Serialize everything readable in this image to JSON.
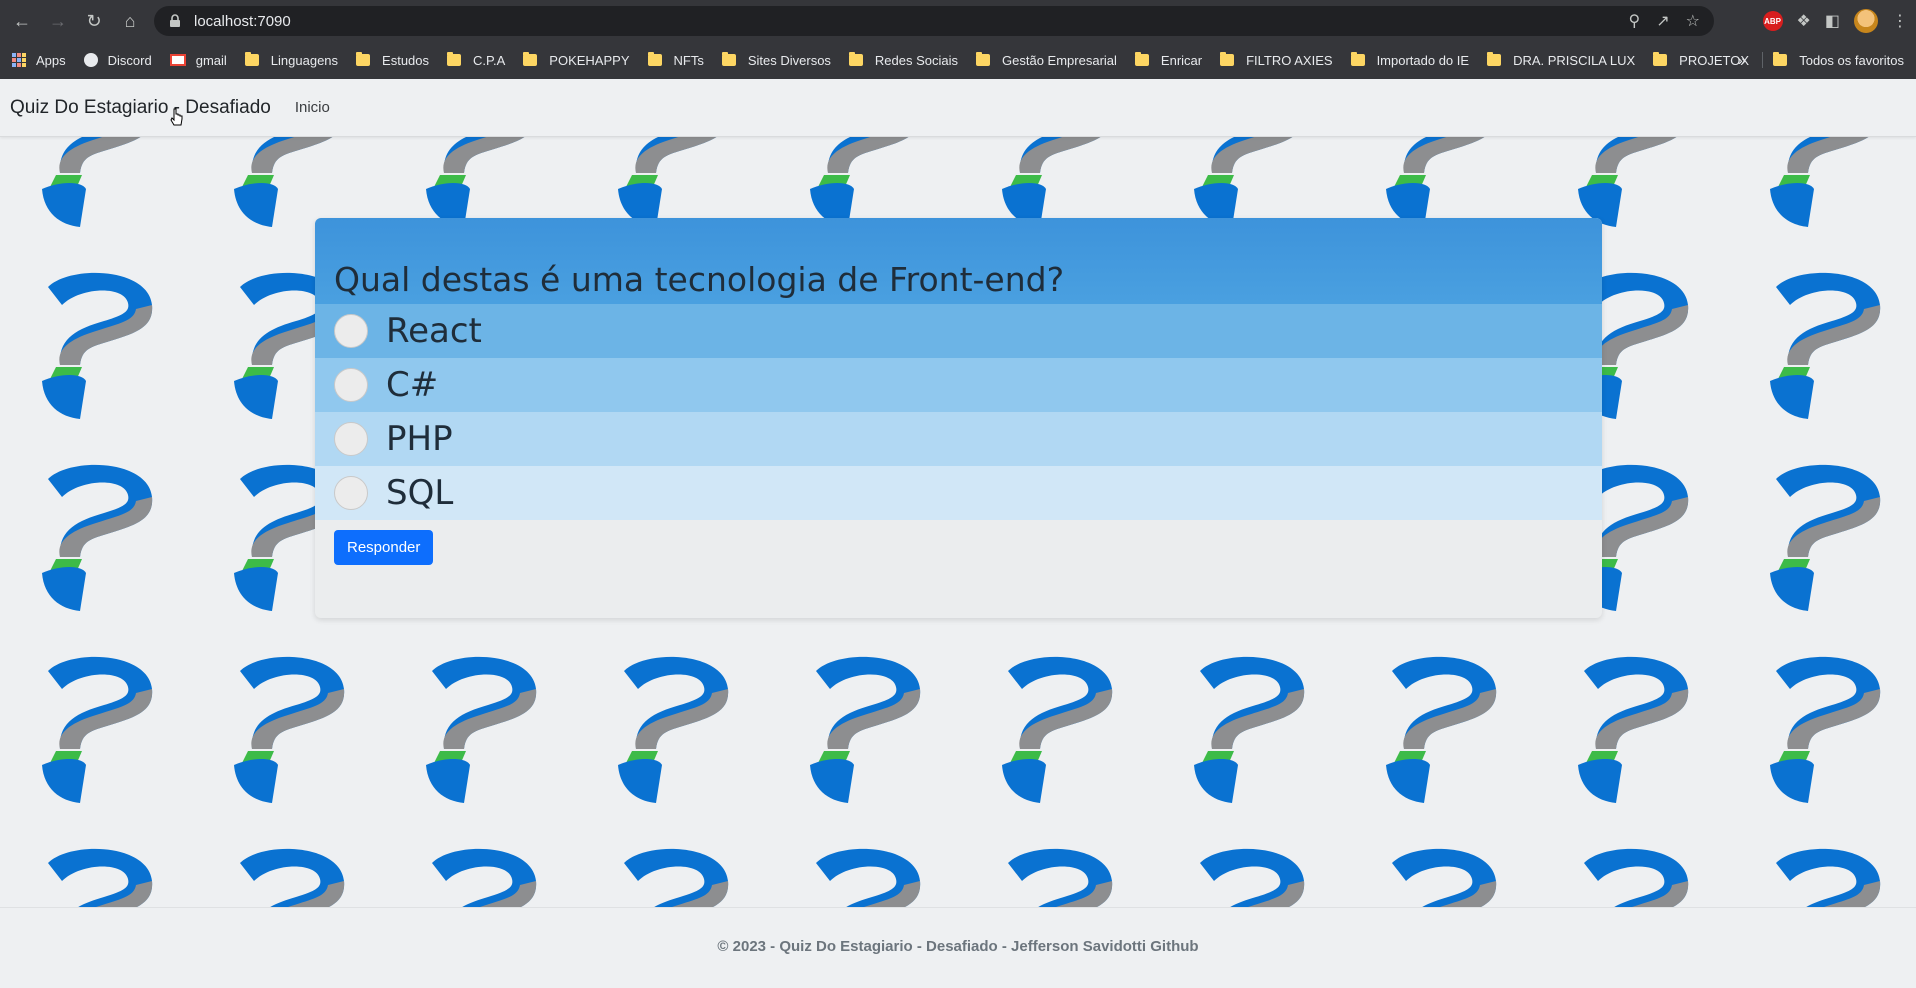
{
  "browser": {
    "url": "localhost:7090",
    "bookmarks": [
      "Apps",
      "Discord",
      "gmail",
      "Linguagens",
      "Estudos",
      "C.P.A",
      "POKEHAPPY",
      "NFTs",
      "Sites Diversos",
      "Redes Sociais",
      "Gestão Empresarial",
      "Enricar",
      "FILTRO AXIES",
      "Importado do IE",
      "DRA. PRISCILA LUX",
      "PROJETOX"
    ],
    "more_label": "»",
    "favorites_label": "Todos os favoritos",
    "abp_label": "ABP"
  },
  "navbar": {
    "brand": "Quiz Do Estagiario - Desafiado",
    "link_inicio": "Inicio"
  },
  "quiz": {
    "question": "Qual destas é uma tecnologia de Front-end?",
    "options": [
      "React",
      "C#",
      "PHP",
      "SQL"
    ],
    "submit_label": "Responder"
  },
  "footer": {
    "text": "© 2023 - Quiz Do Estagiario - Desafiado - Jefferson Savidotti Github"
  },
  "colors": {
    "primary_button": "#0d6efd",
    "question_header": "#3d93db",
    "qmark_blue": "#0a72d1",
    "qmark_gray": "#8d8e90",
    "qmark_green": "#3dbb48"
  }
}
